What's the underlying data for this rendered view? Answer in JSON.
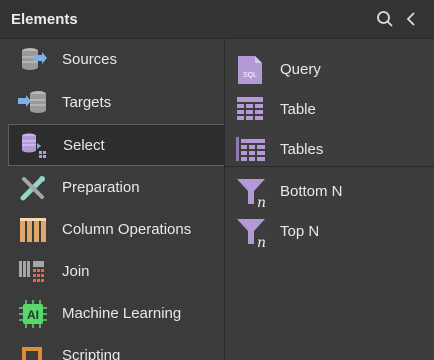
{
  "panel": {
    "title": "Elements"
  },
  "header_icons": [
    "search-icon",
    "chevron-left-icon"
  ],
  "categories": [
    {
      "label": "Sources",
      "icon": "sources-icon"
    },
    {
      "label": "Targets",
      "icon": "targets-icon"
    },
    {
      "label": "Select",
      "icon": "select-icon",
      "selected": true
    },
    {
      "label": "Preparation",
      "icon": "preparation-icon"
    },
    {
      "label": "Column Operations",
      "icon": "column-operations-icon"
    },
    {
      "label": "Join",
      "icon": "join-icon"
    },
    {
      "label": "Machine Learning",
      "icon": "machine-learning-icon"
    },
    {
      "label": "Scripting",
      "icon": "scripting-icon"
    }
  ],
  "elements": {
    "group1": [
      {
        "label": "Query",
        "icon": "sql-file-icon",
        "badge": "SQL"
      },
      {
        "label": "Table",
        "icon": "table-icon"
      },
      {
        "label": "Tables",
        "icon": "tables-icon"
      }
    ],
    "group2": [
      {
        "label": "Bottom N",
        "icon": "funnel-n-icon",
        "glyph": "n"
      },
      {
        "label": "Top N",
        "icon": "funnel-n-icon",
        "glyph": "n"
      }
    ]
  },
  "colors": {
    "accent_purple": "#b39ad6",
    "ai_green": "#57d96c",
    "orange": "#e08a3a",
    "blue": "#7fb0e8"
  }
}
